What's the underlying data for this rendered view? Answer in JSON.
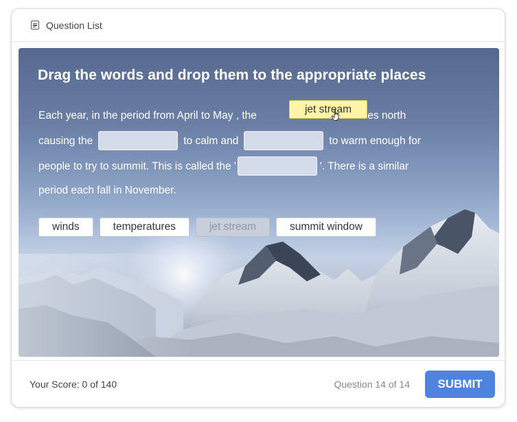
{
  "header": {
    "question_list_label": "Question List"
  },
  "question": {
    "title": "Drag the words and drop them to the appropriate places",
    "lines": [
      {
        "before": "Each year, in the period from April to May , the",
        "after": "moves north"
      },
      {
        "before": "causing the",
        "middle": "to calm and",
        "after": "to warm enough for"
      },
      {
        "before": "people to try to summit. This is called the '",
        "after": "'. There is a similar"
      },
      {
        "before": "period each fall in November."
      }
    ],
    "word_bank": [
      {
        "label": "winds",
        "used": false
      },
      {
        "label": "temperatures",
        "used": false
      },
      {
        "label": "jet stream",
        "used": true
      },
      {
        "label": "summit window",
        "used": false
      }
    ],
    "dragging_word": "jet stream"
  },
  "footer": {
    "score": "Your Score: 0 of 140",
    "progress": "Question 14 of 14",
    "submit_label": "SUBMIT"
  },
  "colors": {
    "accent": "#4e84e0",
    "drag_highlight": "#fff4a8",
    "blank": "#dce2ee"
  },
  "icons": {
    "question_list": "list-icon",
    "cursor": "hand-cursor-icon"
  }
}
